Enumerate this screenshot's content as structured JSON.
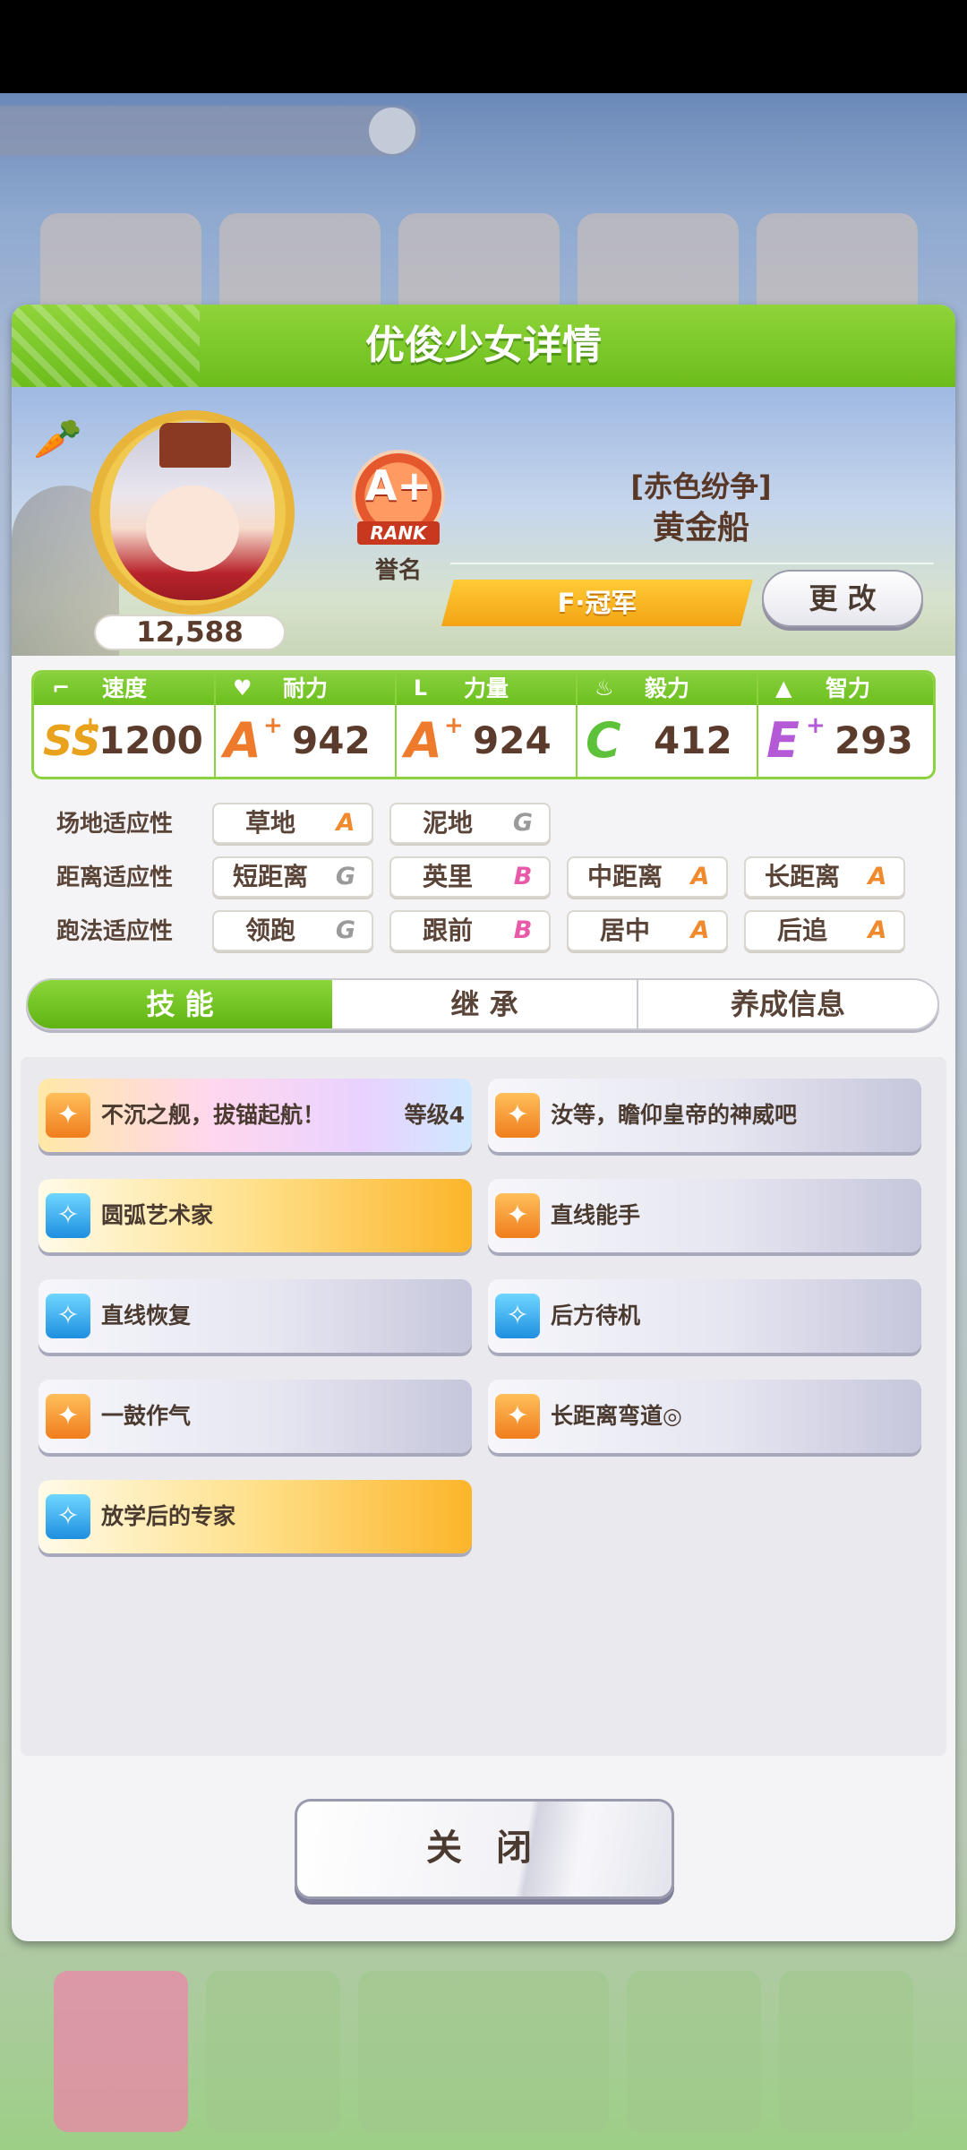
{
  "dialog": {
    "title": "优俊少女详情"
  },
  "profile": {
    "fan_count": "12,588",
    "rank_grade": "A+",
    "rank_label": "RANK",
    "fame_label": "誉名",
    "nickname": "[赤色纷争]",
    "name": "黄金船",
    "title": "F·冠军",
    "change_button": "更 改"
  },
  "stats": [
    {
      "label": "速度",
      "grade": "SS",
      "plus": "+",
      "value": "1200",
      "color": "#e8a21c",
      "icon": "shoe-icon"
    },
    {
      "label": "耐力",
      "grade": "A",
      "plus": "+",
      "value": "942",
      "color": "#ee7b2c",
      "icon": "heart-icon"
    },
    {
      "label": "力量",
      "grade": "A",
      "plus": "+",
      "value": "924",
      "color": "#ee7b2c",
      "icon": "muscle-icon"
    },
    {
      "label": "毅力",
      "grade": "C",
      "plus": "",
      "value": "412",
      "color": "#5dc23a",
      "icon": "flame-icon"
    },
    {
      "label": "智力",
      "grade": "E",
      "plus": "+",
      "value": "293",
      "color": "#b45ad6",
      "icon": "graduation-cap-icon"
    }
  ],
  "aptitude": {
    "track": {
      "label": "场地适应性",
      "items": [
        {
          "name": "草地",
          "grade": "A"
        },
        {
          "name": "泥地",
          "grade": "G"
        }
      ]
    },
    "distance": {
      "label": "距离适应性",
      "items": [
        {
          "name": "短距离",
          "grade": "G"
        },
        {
          "name": "英里",
          "grade": "B"
        },
        {
          "name": "中距离",
          "grade": "A"
        },
        {
          "name": "长距离",
          "grade": "A"
        }
      ]
    },
    "strategy": {
      "label": "跑法适应性",
      "items": [
        {
          "name": "领跑",
          "grade": "G"
        },
        {
          "name": "跟前",
          "grade": "B"
        },
        {
          "name": "居中",
          "grade": "A"
        },
        {
          "name": "后追",
          "grade": "A"
        }
      ]
    }
  },
  "grade_colors": {
    "A": "#f08a2c",
    "B": "#e85aa8",
    "G": "#9a9a9a"
  },
  "tabs": [
    {
      "label": "技 能",
      "active": true
    },
    {
      "label": "继 承",
      "active": false
    },
    {
      "label": "养成信息",
      "active": false
    }
  ],
  "skills": [
    {
      "name": "不沉之舰，拔锚起航！",
      "level": "等级4",
      "style": "rainbow",
      "icon": "fire-icon"
    },
    {
      "name": "汝等，瞻仰皇帝的神威吧",
      "level": "",
      "style": "gray",
      "icon": "fire-icon"
    },
    {
      "name": "圆弧艺术家",
      "level": "",
      "style": "gold",
      "icon": "sparkle-icon"
    },
    {
      "name": "直线能手",
      "level": "",
      "style": "gray",
      "icon": "fire-icon"
    },
    {
      "name": "直线恢复",
      "level": "",
      "style": "gray",
      "icon": "sparkle-icon"
    },
    {
      "name": "后方待机",
      "level": "",
      "style": "gray",
      "icon": "sparkle-icon"
    },
    {
      "name": "一鼓作气",
      "level": "",
      "style": "gray",
      "icon": "fire-icon"
    },
    {
      "name": "长距离弯道◎",
      "level": "",
      "style": "gray",
      "icon": "fire-icon"
    },
    {
      "name": "放学后的专家",
      "level": "",
      "style": "gold",
      "icon": "sparkle-icon"
    }
  ],
  "close_button": "关 闭"
}
